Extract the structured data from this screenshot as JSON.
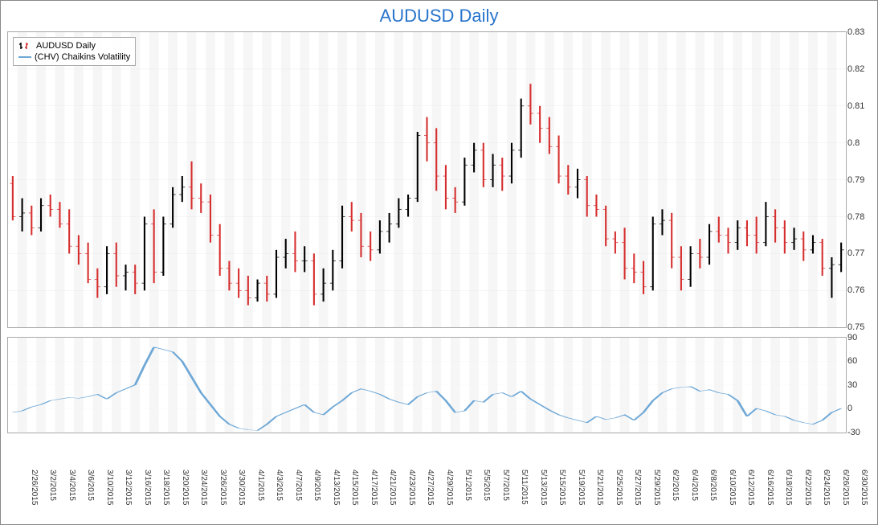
{
  "title": "AUDUSD Daily",
  "legend": {
    "ohlc": "AUDUSD Daily",
    "chv": "(CHV) Chaikins Volatility"
  },
  "chart_data": [
    {
      "type": "ohlc",
      "title": "AUDUSD Daily",
      "ylabel": "",
      "ylim": [
        0.75,
        0.83
      ],
      "yticks": [
        0.75,
        0.76,
        0.77,
        0.78,
        0.79,
        0.8,
        0.81,
        0.82,
        0.83
      ],
      "series_name": "AUDUSD Daily",
      "colors": {
        "up": "#000000",
        "down": "#d62e2e"
      },
      "data": [
        {
          "date": "2/26/2015",
          "o": 0.789,
          "h": 0.791,
          "l": 0.779,
          "c": 0.78
        },
        {
          "date": "2/27/2015",
          "o": 0.78,
          "h": 0.785,
          "l": 0.776,
          "c": 0.781
        },
        {
          "date": "3/2/2015",
          "o": 0.781,
          "h": 0.783,
          "l": 0.775,
          "c": 0.777
        },
        {
          "date": "3/3/2015",
          "o": 0.777,
          "h": 0.785,
          "l": 0.776,
          "c": 0.783
        },
        {
          "date": "3/4/2015",
          "o": 0.783,
          "h": 0.786,
          "l": 0.78,
          "c": 0.782
        },
        {
          "date": "3/5/2015",
          "o": 0.782,
          "h": 0.784,
          "l": 0.777,
          "c": 0.778
        },
        {
          "date": "3/6/2015",
          "o": 0.778,
          "h": 0.782,
          "l": 0.77,
          "c": 0.772
        },
        {
          "date": "3/9/2015",
          "o": 0.772,
          "h": 0.775,
          "l": 0.767,
          "c": 0.77
        },
        {
          "date": "3/10/2015",
          "o": 0.77,
          "h": 0.773,
          "l": 0.762,
          "c": 0.763
        },
        {
          "date": "3/11/2015",
          "o": 0.763,
          "h": 0.766,
          "l": 0.758,
          "c": 0.761
        },
        {
          "date": "3/12/2015",
          "o": 0.761,
          "h": 0.772,
          "l": 0.759,
          "c": 0.77
        },
        {
          "date": "3/13/2015",
          "o": 0.77,
          "h": 0.773,
          "l": 0.761,
          "c": 0.764
        },
        {
          "date": "3/16/2015",
          "o": 0.764,
          "h": 0.767,
          "l": 0.76,
          "c": 0.765
        },
        {
          "date": "3/17/2015",
          "o": 0.765,
          "h": 0.767,
          "l": 0.759,
          "c": 0.762
        },
        {
          "date": "3/18/2015",
          "o": 0.762,
          "h": 0.78,
          "l": 0.76,
          "c": 0.778
        },
        {
          "date": "3/19/2015",
          "o": 0.778,
          "h": 0.782,
          "l": 0.762,
          "c": 0.765
        },
        {
          "date": "3/20/2015",
          "o": 0.765,
          "h": 0.78,
          "l": 0.764,
          "c": 0.778
        },
        {
          "date": "3/23/2015",
          "o": 0.778,
          "h": 0.788,
          "l": 0.777,
          "c": 0.786
        },
        {
          "date": "3/24/2015",
          "o": 0.786,
          "h": 0.791,
          "l": 0.784,
          "c": 0.788
        },
        {
          "date": "3/25/2015",
          "o": 0.788,
          "h": 0.795,
          "l": 0.782,
          "c": 0.785
        },
        {
          "date": "3/26/2015",
          "o": 0.785,
          "h": 0.789,
          "l": 0.781,
          "c": 0.784
        },
        {
          "date": "3/27/2015",
          "o": 0.784,
          "h": 0.786,
          "l": 0.773,
          "c": 0.775
        },
        {
          "date": "3/30/2015",
          "o": 0.775,
          "h": 0.778,
          "l": 0.764,
          "c": 0.766
        },
        {
          "date": "3/31/2015",
          "o": 0.766,
          "h": 0.768,
          "l": 0.76,
          "c": 0.762
        },
        {
          "date": "4/1/2015",
          "o": 0.762,
          "h": 0.766,
          "l": 0.758,
          "c": 0.76
        },
        {
          "date": "4/2/2015",
          "o": 0.76,
          "h": 0.764,
          "l": 0.756,
          "c": 0.758
        },
        {
          "date": "4/3/2015",
          "o": 0.758,
          "h": 0.763,
          "l": 0.757,
          "c": 0.762
        },
        {
          "date": "4/6/2015",
          "o": 0.762,
          "h": 0.764,
          "l": 0.757,
          "c": 0.759
        },
        {
          "date": "4/7/2015",
          "o": 0.759,
          "h": 0.771,
          "l": 0.758,
          "c": 0.769
        },
        {
          "date": "4/8/2015",
          "o": 0.769,
          "h": 0.774,
          "l": 0.766,
          "c": 0.77
        },
        {
          "date": "4/9/2015",
          "o": 0.77,
          "h": 0.776,
          "l": 0.765,
          "c": 0.768
        },
        {
          "date": "4/10/2015",
          "o": 0.768,
          "h": 0.772,
          "l": 0.765,
          "c": 0.768
        },
        {
          "date": "4/13/2015",
          "o": 0.768,
          "h": 0.77,
          "l": 0.756,
          "c": 0.759
        },
        {
          "date": "4/14/2015",
          "o": 0.759,
          "h": 0.766,
          "l": 0.757,
          "c": 0.762
        },
        {
          "date": "4/15/2015",
          "o": 0.762,
          "h": 0.771,
          "l": 0.76,
          "c": 0.768
        },
        {
          "date": "4/16/2015",
          "o": 0.768,
          "h": 0.783,
          "l": 0.766,
          "c": 0.78
        },
        {
          "date": "4/17/2015",
          "o": 0.78,
          "h": 0.784,
          "l": 0.776,
          "c": 0.779
        },
        {
          "date": "4/20/2015",
          "o": 0.779,
          "h": 0.781,
          "l": 0.769,
          "c": 0.772
        },
        {
          "date": "4/21/2015",
          "o": 0.772,
          "h": 0.776,
          "l": 0.768,
          "c": 0.771
        },
        {
          "date": "4/22/2015",
          "o": 0.771,
          "h": 0.779,
          "l": 0.77,
          "c": 0.776
        },
        {
          "date": "4/23/2015",
          "o": 0.776,
          "h": 0.781,
          "l": 0.773,
          "c": 0.778
        },
        {
          "date": "4/24/2015",
          "o": 0.778,
          "h": 0.785,
          "l": 0.777,
          "c": 0.782
        },
        {
          "date": "4/27/2015",
          "o": 0.782,
          "h": 0.786,
          "l": 0.78,
          "c": 0.785
        },
        {
          "date": "4/28/2015",
          "o": 0.785,
          "h": 0.803,
          "l": 0.784,
          "c": 0.802
        },
        {
          "date": "4/29/2015",
          "o": 0.802,
          "h": 0.807,
          "l": 0.795,
          "c": 0.8
        },
        {
          "date": "4/30/2015",
          "o": 0.8,
          "h": 0.804,
          "l": 0.787,
          "c": 0.791
        },
        {
          "date": "5/1/2015",
          "o": 0.791,
          "h": 0.794,
          "l": 0.782,
          "c": 0.785
        },
        {
          "date": "5/4/2015",
          "o": 0.785,
          "h": 0.788,
          "l": 0.781,
          "c": 0.784
        },
        {
          "date": "5/5/2015",
          "o": 0.784,
          "h": 0.796,
          "l": 0.783,
          "c": 0.794
        },
        {
          "date": "5/6/2015",
          "o": 0.794,
          "h": 0.8,
          "l": 0.792,
          "c": 0.798
        },
        {
          "date": "5/7/2015",
          "o": 0.798,
          "h": 0.8,
          "l": 0.788,
          "c": 0.79
        },
        {
          "date": "5/8/2015",
          "o": 0.79,
          "h": 0.797,
          "l": 0.788,
          "c": 0.794
        },
        {
          "date": "5/11/2015",
          "o": 0.794,
          "h": 0.796,
          "l": 0.787,
          "c": 0.791
        },
        {
          "date": "5/12/2015",
          "o": 0.791,
          "h": 0.8,
          "l": 0.789,
          "c": 0.798
        },
        {
          "date": "5/13/2015",
          "o": 0.798,
          "h": 0.812,
          "l": 0.796,
          "c": 0.81
        },
        {
          "date": "5/14/2015",
          "o": 0.81,
          "h": 0.816,
          "l": 0.805,
          "c": 0.808
        },
        {
          "date": "5/15/2015",
          "o": 0.808,
          "h": 0.81,
          "l": 0.8,
          "c": 0.804
        },
        {
          "date": "5/18/2015",
          "o": 0.804,
          "h": 0.807,
          "l": 0.797,
          "c": 0.799
        },
        {
          "date": "5/19/2015",
          "o": 0.799,
          "h": 0.802,
          "l": 0.789,
          "c": 0.791
        },
        {
          "date": "5/20/2015",
          "o": 0.791,
          "h": 0.794,
          "l": 0.786,
          "c": 0.788
        },
        {
          "date": "5/21/2015",
          "o": 0.788,
          "h": 0.793,
          "l": 0.785,
          "c": 0.79
        },
        {
          "date": "5/22/2015",
          "o": 0.79,
          "h": 0.791,
          "l": 0.78,
          "c": 0.783
        },
        {
          "date": "5/25/2015",
          "o": 0.783,
          "h": 0.786,
          "l": 0.78,
          "c": 0.782
        },
        {
          "date": "5/26/2015",
          "o": 0.782,
          "h": 0.783,
          "l": 0.772,
          "c": 0.774
        },
        {
          "date": "5/27/2015",
          "o": 0.774,
          "h": 0.776,
          "l": 0.77,
          "c": 0.773
        },
        {
          "date": "5/28/2015",
          "o": 0.773,
          "h": 0.777,
          "l": 0.763,
          "c": 0.766
        },
        {
          "date": "5/29/2015",
          "o": 0.766,
          "h": 0.77,
          "l": 0.762,
          "c": 0.765
        },
        {
          "date": "6/1/2015",
          "o": 0.765,
          "h": 0.768,
          "l": 0.759,
          "c": 0.761
        },
        {
          "date": "6/2/2015",
          "o": 0.761,
          "h": 0.78,
          "l": 0.76,
          "c": 0.778
        },
        {
          "date": "6/3/2015",
          "o": 0.778,
          "h": 0.782,
          "l": 0.775,
          "c": 0.779
        },
        {
          "date": "6/4/2015",
          "o": 0.779,
          "h": 0.781,
          "l": 0.766,
          "c": 0.769
        },
        {
          "date": "6/5/2015",
          "o": 0.769,
          "h": 0.772,
          "l": 0.76,
          "c": 0.763
        },
        {
          "date": "6/8/2015",
          "o": 0.763,
          "h": 0.772,
          "l": 0.761,
          "c": 0.77
        },
        {
          "date": "6/9/2015",
          "o": 0.77,
          "h": 0.774,
          "l": 0.766,
          "c": 0.769
        },
        {
          "date": "6/10/2015",
          "o": 0.769,
          "h": 0.778,
          "l": 0.767,
          "c": 0.776
        },
        {
          "date": "6/11/2015",
          "o": 0.776,
          "h": 0.78,
          "l": 0.773,
          "c": 0.775
        },
        {
          "date": "6/12/2015",
          "o": 0.775,
          "h": 0.777,
          "l": 0.77,
          "c": 0.773
        },
        {
          "date": "6/15/2015",
          "o": 0.773,
          "h": 0.779,
          "l": 0.771,
          "c": 0.777
        },
        {
          "date": "6/16/2015",
          "o": 0.777,
          "h": 0.779,
          "l": 0.772,
          "c": 0.775
        },
        {
          "date": "6/17/2015",
          "o": 0.775,
          "h": 0.78,
          "l": 0.77,
          "c": 0.773
        },
        {
          "date": "6/18/2015",
          "o": 0.773,
          "h": 0.784,
          "l": 0.772,
          "c": 0.78
        },
        {
          "date": "6/19/2015",
          "o": 0.78,
          "h": 0.782,
          "l": 0.773,
          "c": 0.777
        },
        {
          "date": "6/22/2015",
          "o": 0.777,
          "h": 0.779,
          "l": 0.77,
          "c": 0.773
        },
        {
          "date": "6/23/2015",
          "o": 0.773,
          "h": 0.777,
          "l": 0.771,
          "c": 0.774
        },
        {
          "date": "6/24/2015",
          "o": 0.774,
          "h": 0.776,
          "l": 0.768,
          "c": 0.771
        },
        {
          "date": "6/25/2015",
          "o": 0.771,
          "h": 0.775,
          "l": 0.77,
          "c": 0.773
        },
        {
          "date": "6/26/2015",
          "o": 0.773,
          "h": 0.774,
          "l": 0.764,
          "c": 0.766
        },
        {
          "date": "6/29/2015",
          "o": 0.766,
          "h": 0.769,
          "l": 0.758,
          "c": 0.767
        },
        {
          "date": "6/30/2015",
          "o": 0.767,
          "h": 0.773,
          "l": 0.765,
          "c": 0.771
        }
      ],
      "xticks": [
        "2/26/2015",
        "3/2/2015",
        "3/4/2015",
        "3/6/2015",
        "3/10/2015",
        "3/12/2015",
        "3/16/2015",
        "3/18/2015",
        "3/20/2015",
        "3/24/2015",
        "3/26/2015",
        "3/30/2015",
        "4/1/2015",
        "4/3/2015",
        "4/7/2015",
        "4/9/2015",
        "4/13/2015",
        "4/15/2015",
        "4/17/2015",
        "4/21/2015",
        "4/23/2015",
        "4/27/2015",
        "4/29/2015",
        "5/1/2015",
        "5/5/2015",
        "5/7/2015",
        "5/11/2015",
        "5/13/2015",
        "5/15/2015",
        "5/19/2015",
        "5/21/2015",
        "5/25/2015",
        "5/27/2015",
        "5/29/2015",
        "6/2/2015",
        "6/4/2015",
        "6/8/2015",
        "6/10/2015",
        "6/12/2015",
        "6/16/2015",
        "6/18/2015",
        "6/22/2015",
        "6/24/2015",
        "6/26/2015",
        "6/30/2015"
      ]
    },
    {
      "type": "line",
      "title": "(CHV) Chaikins Volatility",
      "ylabel": "",
      "ylim": [
        -30,
        90
      ],
      "yticks": [
        -30,
        0,
        30,
        60,
        90
      ],
      "color": "#6fa8d6",
      "series_name": "(CHV) Chaikins Volatility",
      "values": [
        -5,
        -3,
        2,
        5,
        10,
        12,
        14,
        13,
        15,
        18,
        12,
        20,
        25,
        30,
        55,
        78,
        75,
        72,
        60,
        40,
        20,
        5,
        -10,
        -20,
        -25,
        -27,
        -28,
        -20,
        -10,
        -5,
        0,
        5,
        -5,
        -8,
        2,
        10,
        20,
        25,
        22,
        18,
        12,
        8,
        5,
        15,
        20,
        22,
        10,
        -5,
        -3,
        10,
        8,
        18,
        20,
        15,
        22,
        12,
        5,
        -2,
        -8,
        -12,
        -15,
        -18,
        -10,
        -14,
        -12,
        -8,
        -15,
        -5,
        10,
        20,
        25,
        27,
        28,
        22,
        24,
        20,
        18,
        10,
        -10,
        0,
        -3,
        -8,
        -10,
        -15,
        -18,
        -20,
        -15,
        -5,
        0
      ]
    }
  ]
}
